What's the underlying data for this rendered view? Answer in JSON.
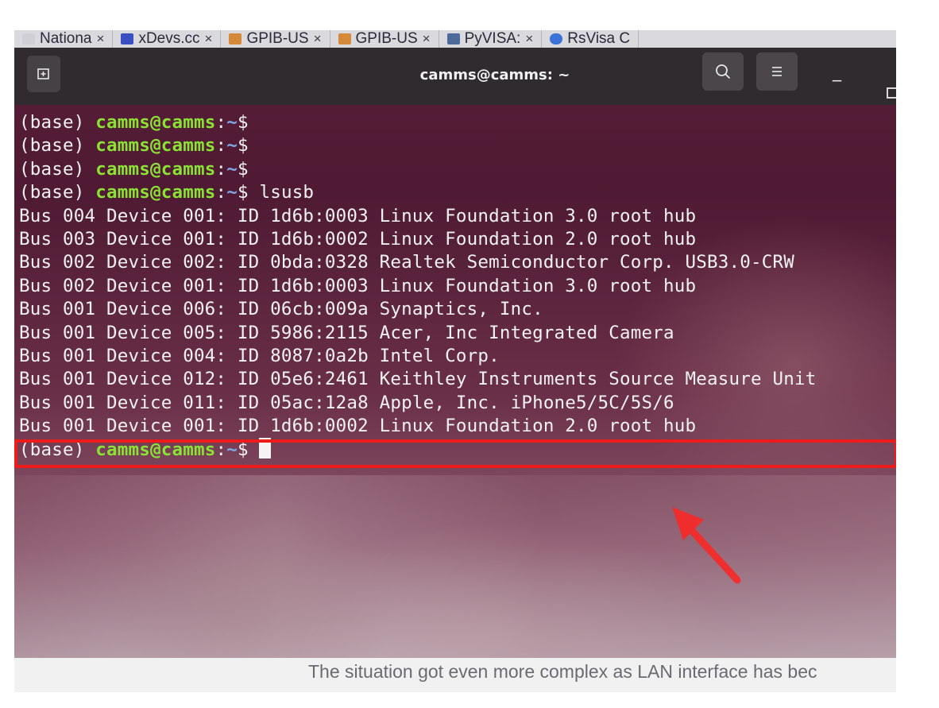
{
  "browser_tabs": [
    {
      "label": "Nationa",
      "favicon_color": "#cfcfd6"
    },
    {
      "label": "xDevs.cc",
      "favicon_color": "#3b4fc4"
    },
    {
      "label": "GPIB-US",
      "favicon_color": "#d58a3a"
    },
    {
      "label": "GPIB-US",
      "favicon_color": "#d58a3a"
    },
    {
      "label": "PyVISA:",
      "favicon_color": "#4d6b9a"
    },
    {
      "label": "RsVisa C",
      "favicon_color": "#3b73d8"
    }
  ],
  "tab_close_glyph": "×",
  "window": {
    "title": "camms@camms: ~",
    "minimize_glyph": "_"
  },
  "terminal": {
    "prompt_env": "(base) ",
    "prompt_user": "camms@camms",
    "prompt_sep": ":",
    "prompt_dir": "~",
    "prompt_symbol": "$",
    "command": " lsusb",
    "output": [
      "Bus 004 Device 001: ID 1d6b:0003 Linux Foundation 3.0 root hub",
      "Bus 003 Device 001: ID 1d6b:0002 Linux Foundation 2.0 root hub",
      "Bus 002 Device 002: ID 0bda:0328 Realtek Semiconductor Corp. USB3.0-CRW",
      "Bus 002 Device 001: ID 1d6b:0003 Linux Foundation 3.0 root hub",
      "Bus 001 Device 006: ID 06cb:009a Synaptics, Inc.",
      "Bus 001 Device 005: ID 5986:2115 Acer, Inc Integrated Camera",
      "Bus 001 Device 004: ID 8087:0a2b Intel Corp.",
      "Bus 001 Device 012: ID 05e6:2461 Keithley Instruments Source Measure Unit",
      "Bus 001 Device 011: ID 05ac:12a8 Apple, Inc. iPhone5/5C/5S/6",
      "Bus 001 Device 001: ID 1d6b:0002 Linux Foundation 2.0 root hub"
    ]
  },
  "annotation": {
    "highlight_color": "#ee1b1b"
  },
  "background_page_text": "The situation got even more complex as LAN interface has bec"
}
